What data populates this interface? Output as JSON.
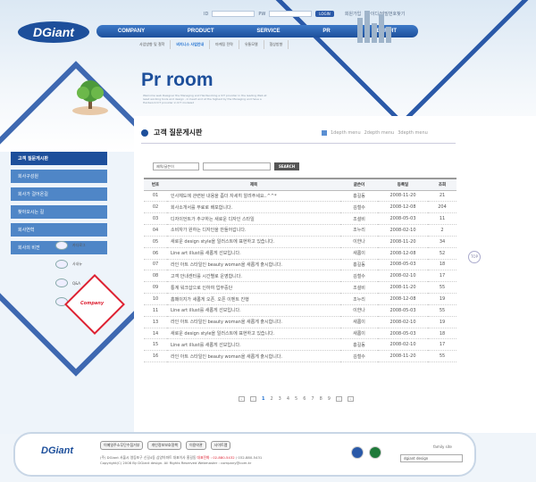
{
  "header": {
    "logo": "DGiant",
    "login": {
      "id_label": "ID",
      "pw_label": "PW",
      "login_button": "LOGIN",
      "links": [
        "회원가입",
        "아이디/비밀번호찾기"
      ]
    }
  },
  "gnb": [
    "COMPANY",
    "PRODUCT",
    "SERVICE",
    "PR",
    "RECRUIT"
  ],
  "subnav": [
    "사업방향 및 철학",
    "비지니스 사업안내",
    "마케팅 전략",
    "유통모델",
    "협상방향"
  ],
  "visual": {
    "title": "Pr room",
    "description": "Welcome web Designer the Managing and Hardworking a ICT provider in the leading Web at least working tools and design , in heart and at the highest by the Managing and have a Hardwork ICT provider in ICT modeled"
  },
  "page": {
    "heading": "고객 질문게시판",
    "breadcrumb": [
      "1depth menu",
      "2depth menu",
      "3depth menu"
    ]
  },
  "lnb": [
    "고객 질문게시판",
    "회사구성원",
    "회사가 걸어온길",
    "찾아오시는 길",
    "회사연혁",
    "회사의 비젼"
  ],
  "quick": [
    "카다로그",
    "사내뉴",
    "Q&A",
    "찾아오시는"
  ],
  "company_badge": "Company",
  "search": {
    "select_label": "제목/글쓴이",
    "button": "SEARCH"
  },
  "table": {
    "headers": [
      "번호",
      "제목",
      "글쓴이",
      "등록일",
      "조회"
    ],
    "rows": [
      [
        "01",
        "인사체도에 관련된 내용을 좀더 자세히 알려주세요..^^*",
        "홍길동",
        "2008-11-20",
        "21"
      ],
      [
        "02",
        "회사소개서를 무료로 배포합니다.",
        "김철수",
        "2008-12-08",
        "204"
      ],
      [
        "03",
        "디자이언트가 추구하는 새로운 디자인 스타일",
        "조설비",
        "2008-05-03",
        "11"
      ],
      [
        "04",
        "소비자가 원하는 디자인을 만들어갑니다.",
        "조누리",
        "2008-02-10",
        "2"
      ],
      [
        "05",
        "새로운 design style을 일러스트에 표현하고 있습니다.",
        "이한나",
        "2008-11-20",
        "34"
      ],
      [
        "06",
        "Line art illust를 새롭게 선보입니다.",
        "새롬이",
        "2008-12-08",
        "52"
      ],
      [
        "07",
        "라인 아트 스타일인 beauty woman을 새롭게 출시합니다.",
        "홍길동",
        "2008-05-03",
        "18"
      ],
      [
        "08",
        "고객 안내센터를 시간별로 운영합니다.",
        "김철수",
        "2008-02-10",
        "17"
      ],
      [
        "09",
        "통계 워크샵으로 인하여 업무중단",
        "조설비",
        "2008-11-20",
        "55"
      ],
      [
        "10",
        "홈페이지가 새롭게 오픈. 오픈 이벤트 진행",
        "조누리",
        "2008-12-08",
        "19"
      ],
      [
        "11",
        "Line art illust를 새롭게 선보입니다.",
        "이한나",
        "2008-05-03",
        "55"
      ],
      [
        "13",
        "라인 아트 스타일인 beauty woman을 새롭게 출시합니다.",
        "새롬이",
        "2008-02-10",
        "19"
      ],
      [
        "14",
        "새로운 design style을 일러스트에 표현하고 있습니다.",
        "새롬이",
        "2008-05-03",
        "18"
      ],
      [
        "15",
        "Line art illust를 새롭게 선보입니다.",
        "홍길동",
        "2008-02-10",
        "17"
      ],
      [
        "16",
        "라인 아트 스타일인 beauty woman을 새롭게 출시합니다.",
        "김철수",
        "2008-11-20",
        "55"
      ]
    ]
  },
  "pager": [
    "1",
    "2",
    "3",
    "4",
    "5",
    "6",
    "7",
    "8",
    "9"
  ],
  "top_button": "TOP",
  "footer": {
    "logo": "DGiant",
    "links": [
      "이메일주소무단수집거부",
      "개인정보보호정책",
      "이용약관",
      "사이트맵"
    ],
    "address": "(주) DGiant 서울시 영등포구 신길4동 삼양아파트 대표이사 홍길동",
    "phone": "대표전화 : 02-880-5432",
    "fax": "/ 032-880-5431",
    "copyright": "Copyright(C) 2008 By DGiant design. All Rights Reserved Webmaster : company@com.kr",
    "family_label": "family site",
    "family_value": "dgiant design"
  }
}
